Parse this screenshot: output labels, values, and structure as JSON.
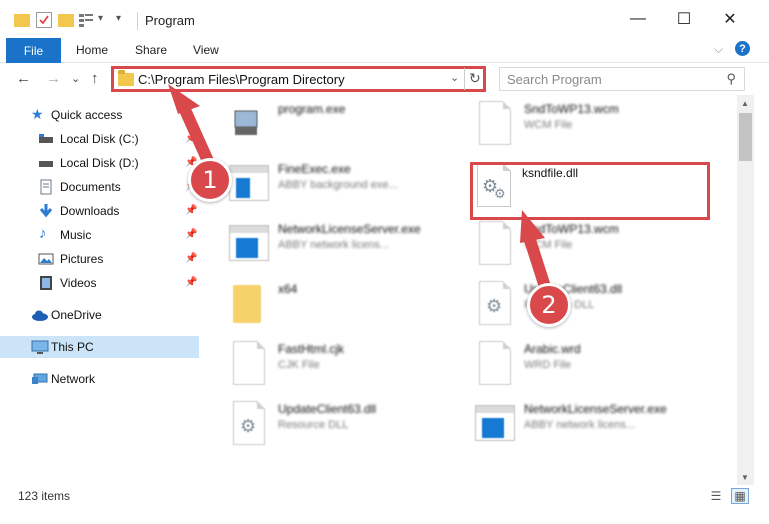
{
  "window": {
    "title": "Program",
    "minimize_glyph": "—",
    "maximize_glyph": "☐",
    "close_glyph": "✕"
  },
  "ribbon": {
    "tabs": [
      "File",
      "Home",
      "Share",
      "View"
    ],
    "expand_glyph": "⌵",
    "help_glyph": "?"
  },
  "nav": {
    "back_glyph": "←",
    "forward_glyph": "→",
    "recent_glyph": "⌄",
    "up_glyph": "↑",
    "address_path": "C:\\Program Files\\Program Directory",
    "address_dropdown_glyph": "⌄",
    "refresh_glyph": "↻",
    "search_placeholder": "Search Program",
    "search_glyph": "⚲"
  },
  "sidebar": {
    "items": [
      {
        "label": "Quick access",
        "icon": "star-icon",
        "pinned": false
      },
      {
        "label": "Local Disk (C:)",
        "icon": "drive-icon",
        "pinned": true
      },
      {
        "label": "Local Disk (D:)",
        "icon": "drive-icon",
        "pinned": true
      },
      {
        "label": "Documents",
        "icon": "documents-icon",
        "pinned": true
      },
      {
        "label": "Downloads",
        "icon": "download-icon",
        "pinned": true
      },
      {
        "label": "Music",
        "icon": "music-icon",
        "pinned": true
      },
      {
        "label": "Pictures",
        "icon": "pictures-icon",
        "pinned": true
      },
      {
        "label": "Videos",
        "icon": "videos-icon",
        "pinned": true
      },
      {
        "label": "OneDrive",
        "icon": "cloud-icon",
        "pinned": false
      },
      {
        "label": "This PC",
        "icon": "monitor-icon",
        "pinned": false,
        "selected": true
      },
      {
        "label": "Network",
        "icon": "network-icon",
        "pinned": false
      }
    ],
    "pin_glyph": "📌"
  },
  "files": [
    {
      "name": "program.exe",
      "sub": "",
      "kind": "exe"
    },
    {
      "name": "SndToWP13.wcm",
      "sub": "WCM File",
      "kind": "doc"
    },
    {
      "name": "FineExec.exe",
      "sub": "ABBY background exe...",
      "kind": "app"
    },
    {
      "name": "ksndfile.dll",
      "sub": "",
      "kind": "dll",
      "highlighted": true
    },
    {
      "name": "NetworkLicenseServer.exe",
      "sub": "ABBY network licens...",
      "kind": "app"
    },
    {
      "name": "SndToWP13.wcm",
      "sub": "WCM File",
      "kind": "doc"
    },
    {
      "name": "x64",
      "sub": "",
      "kind": "folder"
    },
    {
      "name": "UpdateClient63.dll",
      "sub": "Resource DLL",
      "kind": "dll"
    },
    {
      "name": "FastHtml.cjk",
      "sub": "CJK File",
      "kind": "doc"
    },
    {
      "name": "Arabic.wrd",
      "sub": "WRD File",
      "kind": "doc"
    },
    {
      "name": "UpdateClient63.dll",
      "sub": "Resource DLL",
      "kind": "dll"
    },
    {
      "name": "NetworkLicenseServer.exe",
      "sub": "ABBY network licens...",
      "kind": "app"
    }
  ],
  "status": {
    "item_count": "123 items"
  },
  "annotations": {
    "callout_1": "1",
    "callout_2": "2",
    "accent_color": "#d9484b"
  },
  "colors": {
    "file_tab": "#1a73c8",
    "selection": "#cce4f7",
    "highlight": "#d9484b"
  }
}
